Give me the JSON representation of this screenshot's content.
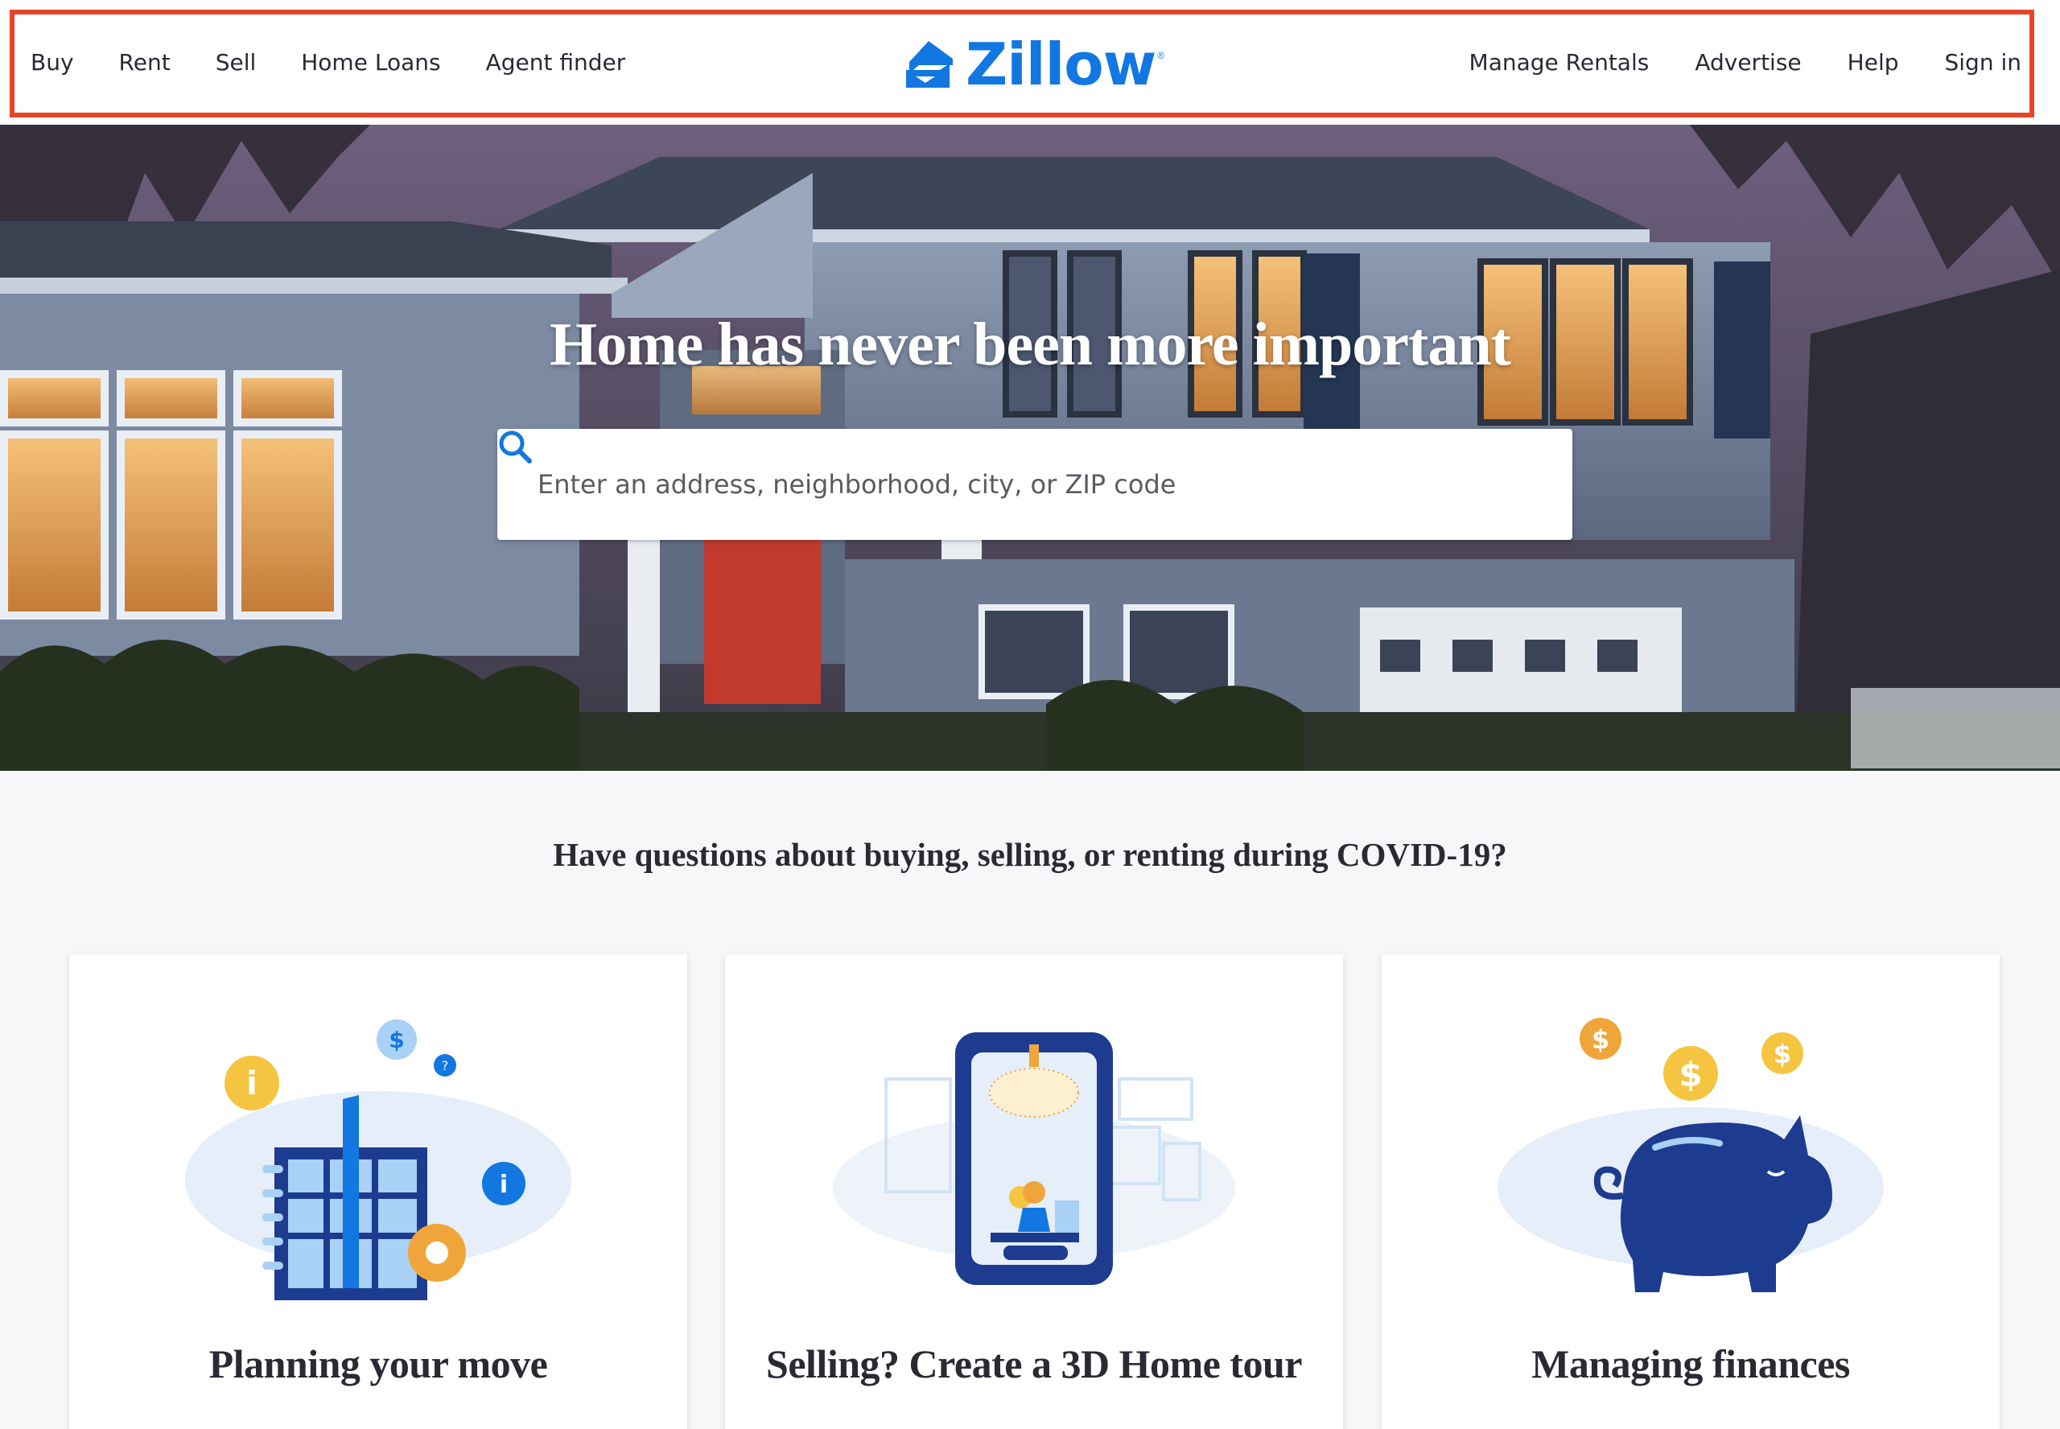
{
  "header": {
    "nav_left": [
      "Buy",
      "Rent",
      "Sell",
      "Home Loans",
      "Agent finder"
    ],
    "nav_right": [
      "Manage Rentals",
      "Advertise",
      "Help",
      "Sign in"
    ],
    "logo_text": "Zillow",
    "logo_mark": "®"
  },
  "hero": {
    "title": "Home has never been more important",
    "search_placeholder": "Enter an address, neighborhood, city, or ZIP code",
    "search_icon": "search-icon"
  },
  "covid": {
    "question": "Have questions about buying, selling, or renting during COVID-19?"
  },
  "cards": [
    {
      "title": "Planning your move",
      "icon": "planning-illustration"
    },
    {
      "title": "Selling? Create a 3D Home tour",
      "icon": "3d-tour-illustration"
    },
    {
      "title": "Managing finances",
      "icon": "piggy-bank-illustration"
    }
  ],
  "colors": {
    "brand_blue": "#1277e1",
    "highlight_red": "#e8442b",
    "text_dark": "#2a2a33",
    "accent_yellow": "#f5c542",
    "accent_navy": "#1d3c8f"
  }
}
